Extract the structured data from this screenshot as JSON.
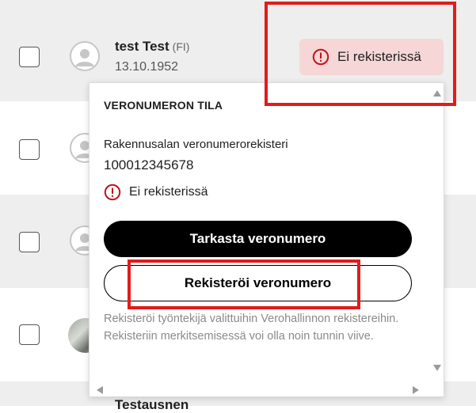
{
  "rows": [
    {
      "name": "test Test",
      "country": "(FI)",
      "date": "13.10.1952"
    },
    {
      "name": "",
      "country": "",
      "date": ""
    },
    {
      "name": "",
      "country": "",
      "date": ""
    },
    {
      "name": "",
      "country": "",
      "date": ""
    },
    {
      "name": "Testausnen",
      "country": "",
      "date": ""
    }
  ],
  "status_badge": {
    "label": "Ei rekisterissä",
    "icon": "alert-circle-icon",
    "bg": "#f6d6d6",
    "icon_color": "#c0141b"
  },
  "popup": {
    "title": "VERONUMERON TILA",
    "register_name": "Rakennusalan veronumerorekisteri",
    "tax_number": "100012345678",
    "status_label": "Ei rekisterissä",
    "check_button": "Tarkasta veronumero",
    "register_button": "Rekisteröi veronumero",
    "help_text": "Rekisteröi työntekijä valittuihin Verohallinnon rekistereihin. Rekisteriin merkitsemisessä voi olla noin tunnin viive."
  },
  "colors": {
    "highlight": "#e21b1b",
    "row_alt": "#eeeeee",
    "alert": "#c0141b"
  }
}
